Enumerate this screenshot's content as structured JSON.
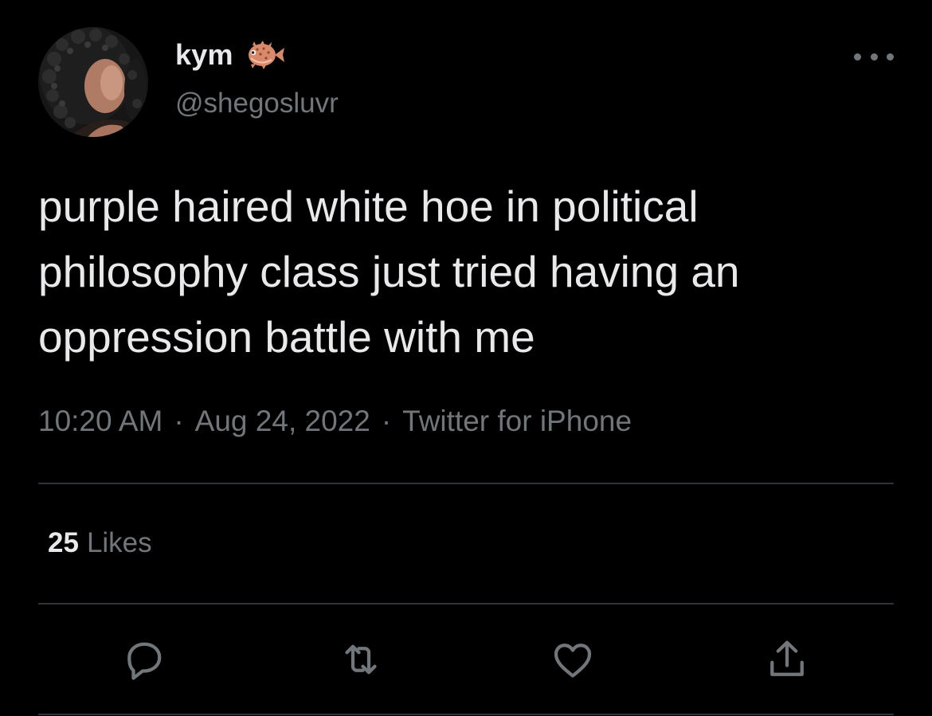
{
  "user": {
    "display_name": "kym",
    "name_emoji_icon": "blowfish-icon",
    "handle": "@shegosluvr",
    "avatar": "profile-photo"
  },
  "tweet": {
    "text_lines": [
      "purple haired white hoe in political",
      "philosophy class just tried having an",
      "oppression battle with me"
    ]
  },
  "meta": {
    "time": "10:20 AM",
    "separator": "·",
    "date": "Aug 24, 2022",
    "source": "Twitter for iPhone"
  },
  "stats": {
    "likes_count": "25",
    "likes_label": "Likes"
  },
  "actions": {
    "reply_icon": "reply-icon",
    "retweet_icon": "retweet-icon",
    "like_icon": "heart-icon",
    "share_icon": "share-icon",
    "more_icon": "more-icon"
  },
  "colors": {
    "background": "#000000",
    "primary_text": "#e7e9ea",
    "secondary_text": "#71767b",
    "divider": "#2f3336",
    "emoji_body": "#d9896a"
  }
}
